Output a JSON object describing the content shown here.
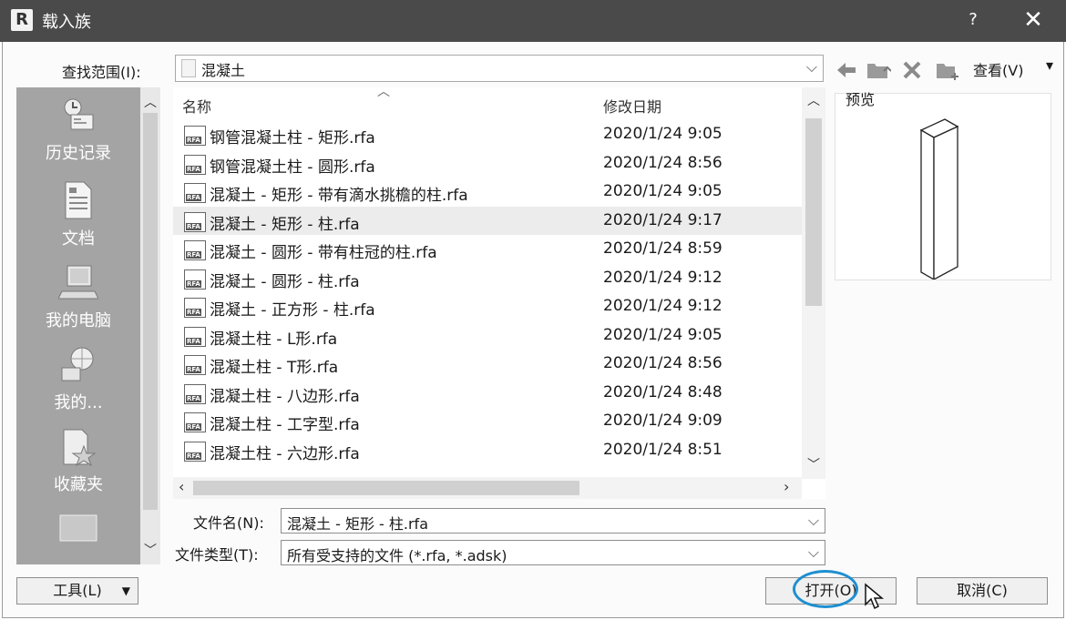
{
  "window": {
    "title": "载入族",
    "logo": "R",
    "help": "?",
    "close": "✕"
  },
  "lookin": {
    "label": "查找范围(I):",
    "value": "混凝土"
  },
  "toolbar": {
    "view_label": "查看(V)"
  },
  "places": [
    {
      "label": "历史记录",
      "icon": "history-icon"
    },
    {
      "label": "文档",
      "icon": "documents-icon"
    },
    {
      "label": "我的电脑",
      "icon": "computer-icon"
    },
    {
      "label": "我的...",
      "icon": "network-icon"
    },
    {
      "label": "收藏夹",
      "icon": "favorites-icon"
    }
  ],
  "filelist": {
    "columns": {
      "name": "名称",
      "date": "修改日期"
    },
    "selected_index": 3,
    "files": [
      {
        "name": "钢管混凝土柱 - 矩形.rfa",
        "date": "2020/1/24 9:05"
      },
      {
        "name": "钢管混凝土柱 - 圆形.rfa",
        "date": "2020/1/24 8:56"
      },
      {
        "name": "混凝土 - 矩形 - 带有滴水挑檐的柱.rfa",
        "date": "2020/1/24 9:05"
      },
      {
        "name": "混凝土 - 矩形 - 柱.rfa",
        "date": "2020/1/24 9:17"
      },
      {
        "name": "混凝土 - 圆形 - 带有柱冠的柱.rfa",
        "date": "2020/1/24 8:59"
      },
      {
        "name": "混凝土 - 圆形 - 柱.rfa",
        "date": "2020/1/24 9:12"
      },
      {
        "name": "混凝土 - 正方形 - 柱.rfa",
        "date": "2020/1/24 9:12"
      },
      {
        "name": "混凝土柱 - L形.rfa",
        "date": "2020/1/24 9:05"
      },
      {
        "name": "混凝土柱 - T形.rfa",
        "date": "2020/1/24 8:56"
      },
      {
        "name": "混凝土柱 - 八边形.rfa",
        "date": "2020/1/24 8:48"
      },
      {
        "name": "混凝土柱 - 工字型.rfa",
        "date": "2020/1/24 9:09"
      },
      {
        "name": "混凝土柱 - 六边形.rfa",
        "date": "2020/1/24 8:51"
      }
    ]
  },
  "preview": {
    "label": "预览"
  },
  "filename": {
    "label": "文件名(N):",
    "value": "混凝土 - 矩形 - 柱.rfa"
  },
  "filetype": {
    "label": "文件类型(T):",
    "value": "所有受支持的文件 (*.rfa, *.adsk)"
  },
  "buttons": {
    "tools": "工具(L)",
    "open": "打开(O)",
    "cancel": "取消(C)"
  },
  "colors": {
    "titlebar": "#4a4a4a",
    "places_bg": "#a4a4a4",
    "selected_row": "#ececec",
    "highlight_ring": "#1e8fd0"
  }
}
